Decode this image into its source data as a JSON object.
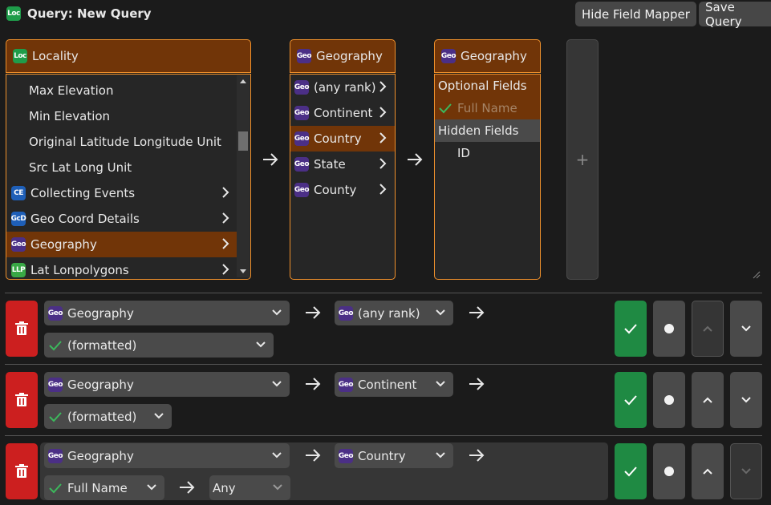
{
  "header": {
    "title": "Query: New Query",
    "badge": "Loc",
    "hide_mapper": "Hide Field Mapper",
    "save_query": "Save Query"
  },
  "mapper": {
    "locality": {
      "title": "Locality",
      "badge": "Loc",
      "items": [
        {
          "label": "Max Elevation"
        },
        {
          "label": "Min Elevation"
        },
        {
          "label": "Original Latitude Longitude Unit"
        },
        {
          "label": "Src Lat Long Unit"
        },
        {
          "label": "Collecting Events",
          "badge": "CE"
        },
        {
          "label": "Geo Coord Details",
          "badge": "GcD"
        },
        {
          "label": "Geography",
          "badge": "Geo"
        },
        {
          "label": "Lat Lonpolygons",
          "badge": "LLP"
        }
      ]
    },
    "geography1": {
      "title": "Geography",
      "badge": "Geo",
      "items": [
        {
          "label": "(any rank)",
          "badge": "Geo"
        },
        {
          "label": "Continent",
          "badge": "Geo"
        },
        {
          "label": "Country",
          "badge": "Geo"
        },
        {
          "label": "State",
          "badge": "Geo"
        },
        {
          "label": "County",
          "badge": "Geo"
        }
      ]
    },
    "geography2": {
      "title": "Geography",
      "badge": "Geo",
      "optional_label": "Optional Fields",
      "optional_item": "Full Name",
      "hidden_label": "Hidden Fields",
      "hidden_item": "ID"
    },
    "add_label": "+"
  },
  "lines": [
    {
      "table": "Geography",
      "rank": "(any rank)",
      "field": "(formatted)",
      "badge": "Geo"
    },
    {
      "table": "Geography",
      "rank": "Continent",
      "field": "(formatted)",
      "badge": "Geo"
    },
    {
      "table": "Geography",
      "rank": "Country",
      "field": "Full Name",
      "operator": "Any",
      "badge": "Geo"
    }
  ],
  "colors": {
    "accent": "#713508",
    "border": "#f0912c",
    "delete": "#cc1f1f",
    "success": "#1f8a43"
  }
}
